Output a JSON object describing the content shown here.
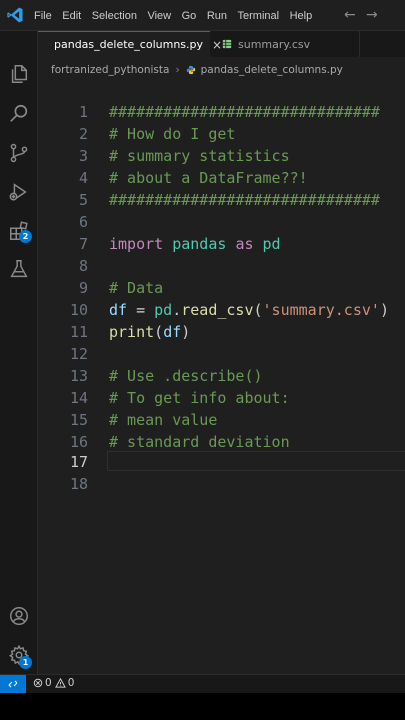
{
  "menu": [
    "File",
    "Edit",
    "Selection",
    "View",
    "Go",
    "Run",
    "Terminal",
    "Help"
  ],
  "nav": {
    "back": "←",
    "forward": "→"
  },
  "tabs": [
    {
      "label": "pandas_delete_columns.py",
      "active": true,
      "close": "×"
    },
    {
      "label": "summary.csv",
      "active": false
    }
  ],
  "breadcrumb": {
    "folder": "fortranized_pythonista",
    "separator": "›",
    "file": "pandas_delete_columns.py"
  },
  "badges": {
    "extensions": "2",
    "settings": "1"
  },
  "editor": {
    "current_line": 17,
    "lines": [
      {
        "n": "1",
        "text": "##############################"
      },
      {
        "n": "2",
        "text": "# How do I get"
      },
      {
        "n": "3",
        "text": "# summary statistics"
      },
      {
        "n": "4",
        "text": "# about a DataFrame??!"
      },
      {
        "n": "5",
        "text": "##############################"
      },
      {
        "n": "6",
        "text": ""
      },
      {
        "n": "7",
        "text": "import pandas as pd"
      },
      {
        "n": "8",
        "text": ""
      },
      {
        "n": "9",
        "text": "# Data"
      },
      {
        "n": "10",
        "text": "df = pd.read_csv('summary.csv')"
      },
      {
        "n": "11",
        "text": "print(df)"
      },
      {
        "n": "12",
        "text": ""
      },
      {
        "n": "13",
        "text": "# Use .describe()"
      },
      {
        "n": "14",
        "text": "# To get info about:"
      },
      {
        "n": "15",
        "text": "# mean value"
      },
      {
        "n": "16",
        "text": "# standard deviation"
      },
      {
        "n": "17",
        "text": ""
      },
      {
        "n": "18",
        "text": ""
      }
    ]
  },
  "status": {
    "errors": "0",
    "warnings": "0"
  },
  "colors": {
    "accent": "#0078d4",
    "comment": "#6a9955",
    "keyword": "#c586c0",
    "string": "#ce9178"
  }
}
